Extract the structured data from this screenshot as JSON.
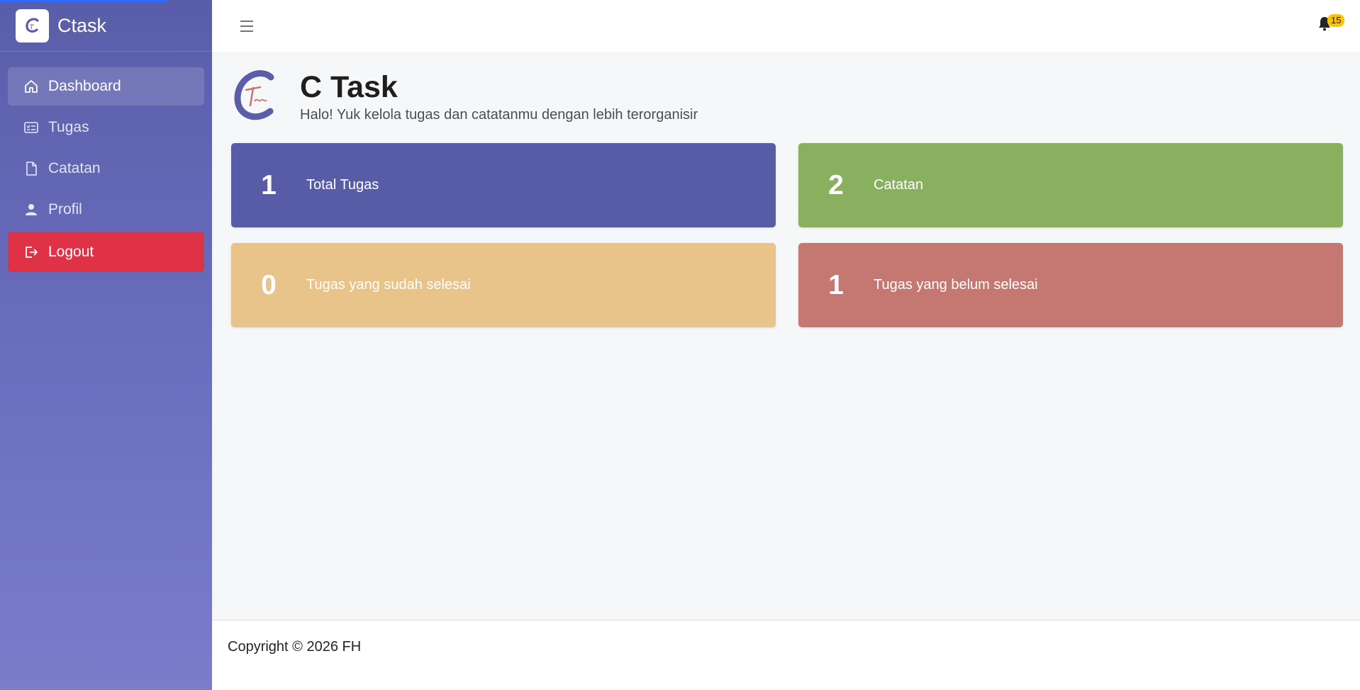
{
  "app": {
    "name": "Ctask"
  },
  "sidebar": {
    "items": [
      {
        "label": "Dashboard",
        "icon": "home-icon"
      },
      {
        "label": "Tugas",
        "icon": "task-list-icon"
      },
      {
        "label": "Catatan",
        "icon": "file-icon"
      },
      {
        "label": "Profil",
        "icon": "user-icon"
      },
      {
        "label": "Logout",
        "icon": "logout-icon"
      }
    ]
  },
  "topbar": {
    "notification_count": "15"
  },
  "header": {
    "title": "C Task",
    "subtitle": "Halo! Yuk kelola tugas dan catatanmu dengan lebih terorganisir"
  },
  "cards": [
    {
      "value": "1",
      "label": "Total Tugas",
      "color": "#585ba6"
    },
    {
      "value": "2",
      "label": "Catatan",
      "color": "#89b05f"
    },
    {
      "value": "0",
      "label": "Tugas yang sudah selesai",
      "color": "#e8c38a"
    },
    {
      "value": "1",
      "label": "Tugas yang belum selesai",
      "color": "#c57872"
    }
  ],
  "footer": {
    "text": "Copyright © 2026 FH"
  },
  "colors": {
    "sidebar": "#5a5ea9",
    "logout": "#e03247",
    "badge": "#ffc107"
  }
}
